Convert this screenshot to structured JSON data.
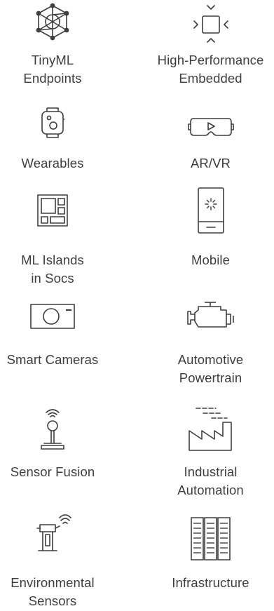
{
  "categories": [
    {
      "key": "tinyml",
      "label": "TinyML\nEndpoints",
      "icon": "network-node-icon"
    },
    {
      "key": "hpe",
      "label": "High-Performance\nEmbedded",
      "icon": "expand-chip-icon"
    },
    {
      "key": "wearables",
      "label": "Wearables",
      "icon": "smartwatch-icon"
    },
    {
      "key": "arvr",
      "label": "AR/VR",
      "icon": "vr-headset-icon"
    },
    {
      "key": "islands",
      "label": "ML Islands\nin Socs",
      "icon": "soc-layout-icon"
    },
    {
      "key": "mobile",
      "label": "Mobile",
      "icon": "mobile-phone-icon"
    },
    {
      "key": "cameras",
      "label": "Smart Cameras",
      "icon": "camera-icon"
    },
    {
      "key": "automotive",
      "label": "Automotive\nPowertrain",
      "icon": "engine-icon"
    },
    {
      "key": "fusion",
      "label": "Sensor Fusion",
      "icon": "joystick-sensor-icon"
    },
    {
      "key": "industrial",
      "label": "Industrial\nAutomation",
      "icon": "factory-icon"
    },
    {
      "key": "environmental",
      "label": "Environmental\nSensors",
      "icon": "weather-station-icon"
    },
    {
      "key": "infrastructure",
      "label": "Infrastructure",
      "icon": "server-racks-icon"
    }
  ]
}
